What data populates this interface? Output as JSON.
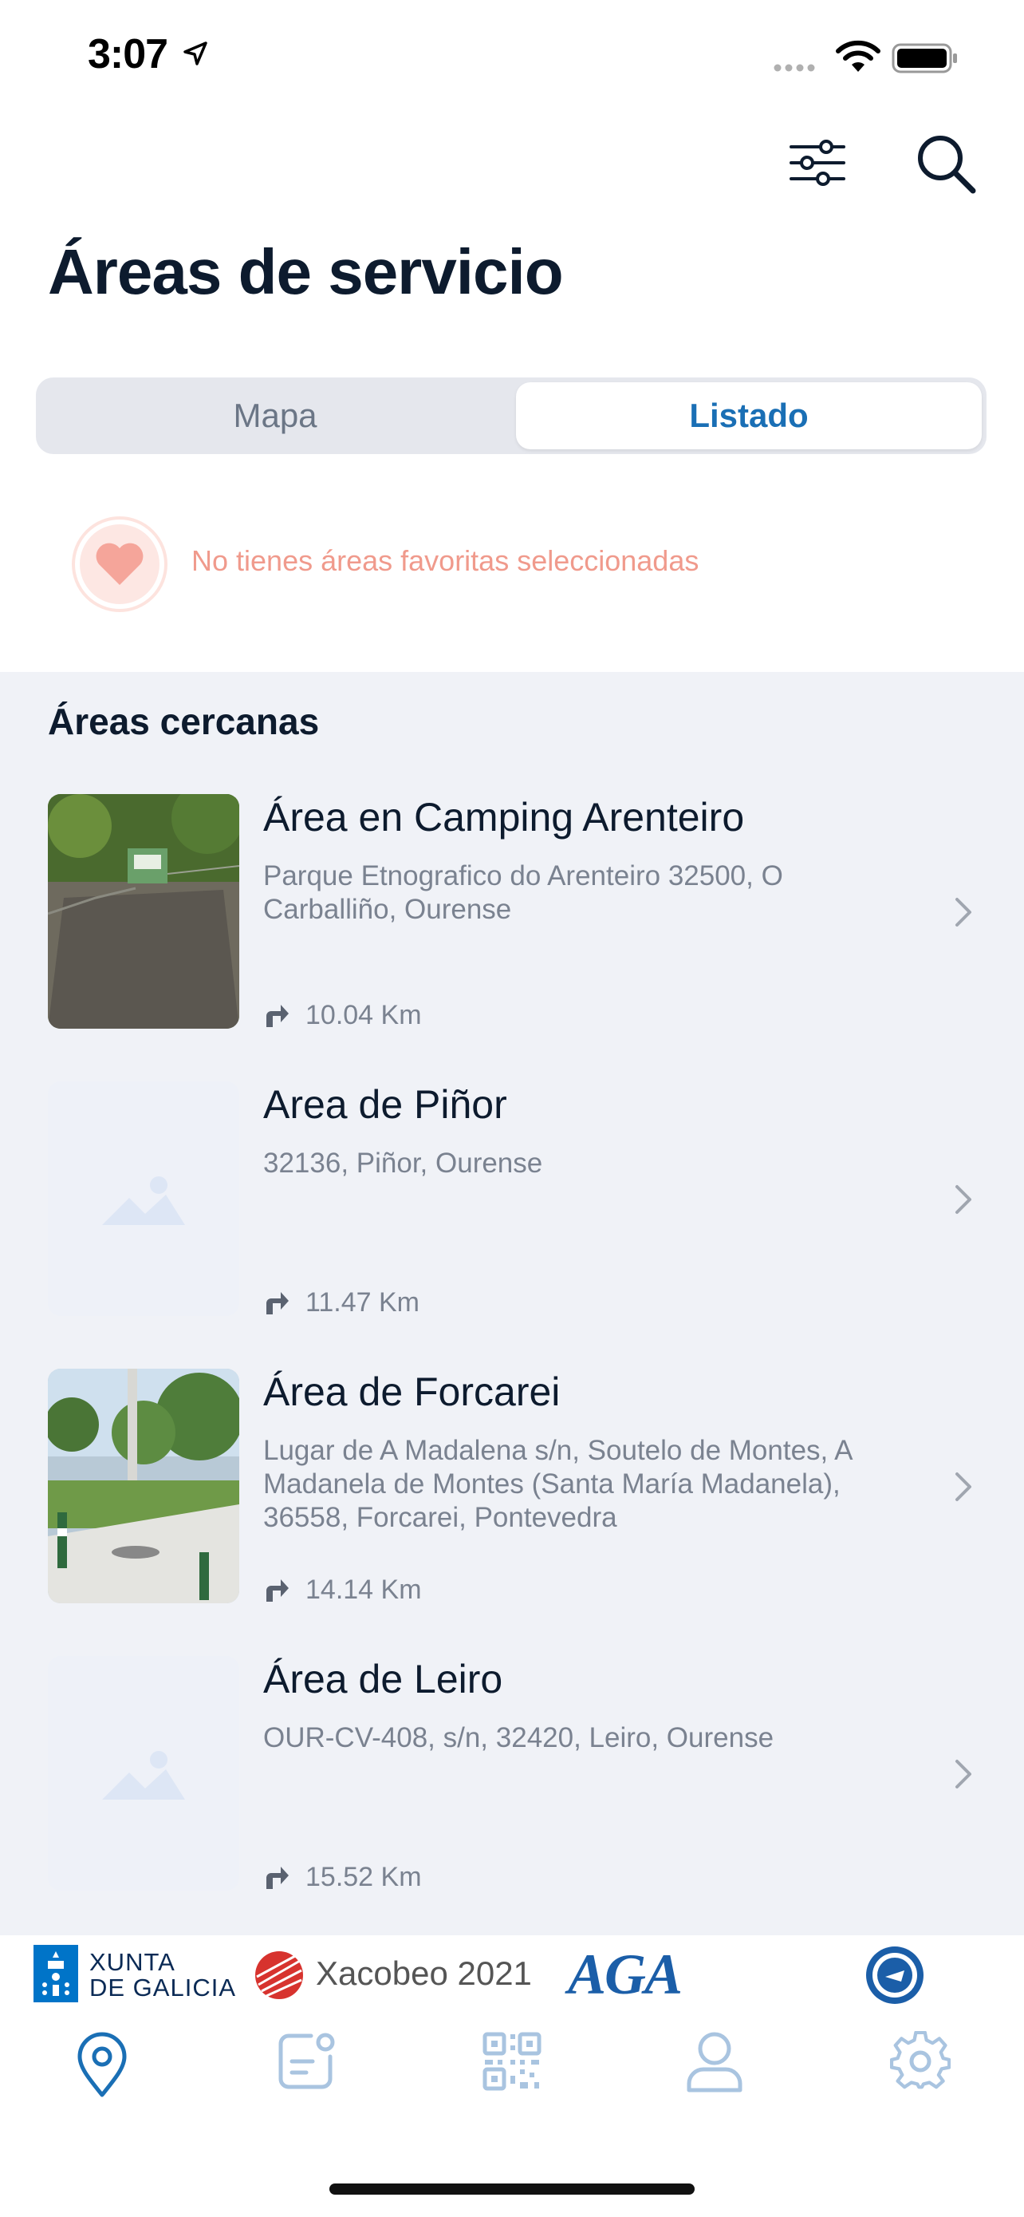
{
  "status_bar": {
    "time": "3:07"
  },
  "header": {
    "title": "Áreas de servicio"
  },
  "segmented": {
    "map_label": "Mapa",
    "list_label": "Listado",
    "selected": "Listado"
  },
  "favorites": {
    "empty_text": "No tienes áreas favoritas seleccionadas"
  },
  "nearby": {
    "title": "Áreas cercanas",
    "items": [
      {
        "title": "Área en Camping Arenteiro",
        "address": "Parque Etnografico do Arenteiro 32500, O Carballiño, Ourense",
        "distance": "10.04 Km",
        "has_photo": true
      },
      {
        "title": "Area de Piñor",
        "address": "32136, Piñor, Ourense",
        "distance": "11.47 Km",
        "has_photo": false
      },
      {
        "title": "Área de Forcarei",
        "address": "Lugar de A Madalena s/n, Soutelo de Montes, A Madanela de Montes (Santa María Madanela), 36558, Forcarei, Pontevedra",
        "distance": "14.14 Km",
        "has_photo": true
      },
      {
        "title": "Área de Leiro",
        "address": "OUR-CV-408,  s/n, 32420, Leiro, Ourense",
        "distance": "15.52 Km",
        "has_photo": false
      }
    ]
  },
  "sponsors": {
    "xunta": "XUNTA DE GALICIA",
    "xacobeo": "Xacobeo 2021",
    "aga": "AGA"
  },
  "tabbar": {
    "items": [
      {
        "icon": "map-pin-icon",
        "active": true
      },
      {
        "icon": "notes-icon",
        "active": false
      },
      {
        "icon": "qr-code-icon",
        "active": false
      },
      {
        "icon": "user-icon",
        "active": false
      },
      {
        "icon": "gear-icon",
        "active": false
      }
    ]
  },
  "colors": {
    "accent": "#1a6fb5",
    "tab_inactive": "#a9c4e0",
    "favorite": "#f09a8c",
    "list_bg": "#f0f2f7"
  }
}
